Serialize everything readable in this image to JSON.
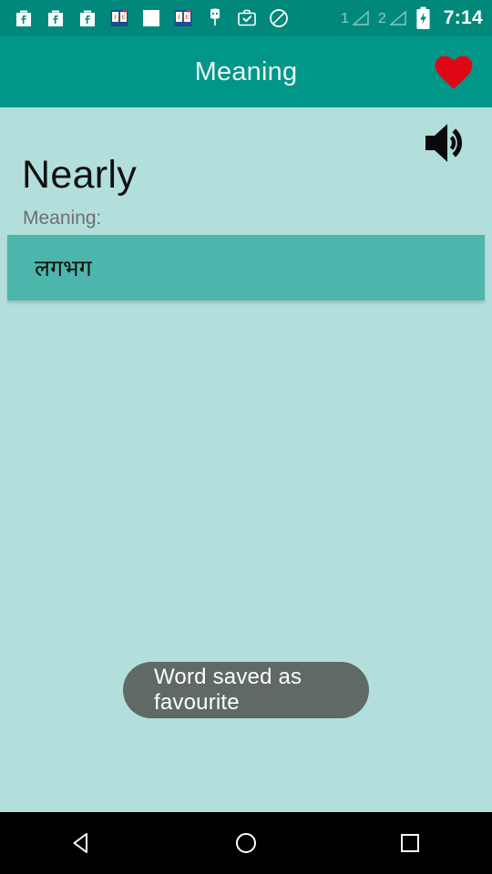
{
  "statusbar": {
    "icons": [
      {
        "name": "flipkart-notification-icon",
        "label": "Flipkart"
      },
      {
        "name": "flipkart-notification-icon-2",
        "label": "Flipkart"
      },
      {
        "name": "flipkart-notification-icon-3",
        "label": "Flipkart"
      },
      {
        "name": "dictionary-book-icon",
        "label": "J E"
      },
      {
        "name": "blank-notification-icon",
        "label": ""
      },
      {
        "name": "dictionary-book-icon-2",
        "label": "J E"
      },
      {
        "name": "android-robot-icon",
        "label": ""
      },
      {
        "name": "briefcase-check-icon",
        "label": ""
      },
      {
        "name": "do-not-disturb-icon",
        "label": ""
      }
    ],
    "sim1_label": "1",
    "sim2_label": "2",
    "battery": "charging",
    "time": "7:14"
  },
  "appbar": {
    "title": "Meaning",
    "favourite_icon": "heart-icon",
    "favourite_color": "#e00714"
  },
  "content": {
    "speaker_icon": "speaker-volume-icon",
    "word": "Nearly",
    "meaning_label": "Meaning:",
    "meaning_value": "लगभग",
    "card_color": "#4db6ac",
    "background_color": "#b2dfdb"
  },
  "toast": {
    "message": "Word saved as favourite",
    "background": "#5f6965"
  },
  "navbar": {
    "back_icon": "back-triangle-icon",
    "home_icon": "home-circle-icon",
    "recents_icon": "recents-square-icon"
  }
}
